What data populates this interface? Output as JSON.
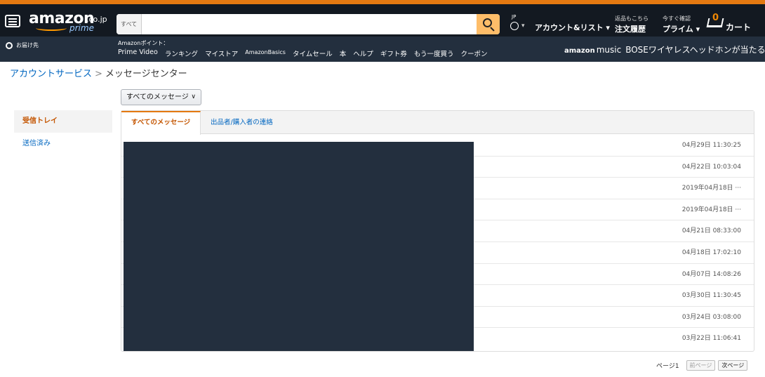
{
  "header": {
    "logo": {
      "word": "amazon",
      "tld": ".co.jp",
      "sub": "prime"
    },
    "search": {
      "category": "すべて ▾",
      "value": "",
      "placeholder": ""
    },
    "lang": "JP",
    "account": "アカウント&リスト ▾",
    "orders": {
      "small": "返品もこちら",
      "big": "注文履歴"
    },
    "prime": {
      "small": "今すぐ確認",
      "big": "プライム ▾"
    },
    "cart": {
      "count": "0",
      "label": "カート"
    },
    "deliver_to": "お届け先",
    "points": "Amazonポイント：",
    "links": [
      "Prime Video",
      "ランキング",
      "マイストア",
      "AmazonBasics",
      "タイムセール",
      "本",
      "ヘルプ",
      "ギフト券",
      "もう一度買う",
      "クーポン"
    ],
    "promo": {
      "brand": "amazon",
      "brand_suffix": "music",
      "text": "BOSEワイヤレスヘッドホンが当たる"
    }
  },
  "breadcrumb": {
    "parent": "アカウントサービス",
    "separator": ">",
    "current": "メッセージセンター"
  },
  "filter": {
    "selected": "すべてのメッセージ",
    "chevron": "∨"
  },
  "sidebar": {
    "items": [
      {
        "label": "受信トレイ",
        "active": true
      },
      {
        "label": "送信済み",
        "active": false
      }
    ]
  },
  "tabs": [
    {
      "label": "すべてのメッセージ",
      "active": true
    },
    {
      "label": "出品者/購入者の連絡",
      "active": false
    }
  ],
  "messages": [
    {
      "date": "04月29日 11:30:25"
    },
    {
      "date": "04月22日 10:03:04"
    },
    {
      "date": "2019年04月18日 ···"
    },
    {
      "date": "2019年04月18日 ···"
    },
    {
      "date": "04月21日 08:33:00"
    },
    {
      "date": "04月18日 17:02:10"
    },
    {
      "date": "04月07日 14:08:26"
    },
    {
      "date": "03月30日 11:30:45"
    },
    {
      "date": "03月24日 03:08:00"
    },
    {
      "date": "03月22日 11:06:41"
    }
  ],
  "pager": {
    "label": "ページ1",
    "prev": "前ページ",
    "next": "次ページ"
  },
  "colors": {
    "nav_dark": "#131921",
    "nav_sub": "#232f3e",
    "accent": "#e47911",
    "link": "#0066c0",
    "active_text": "#c45500"
  }
}
